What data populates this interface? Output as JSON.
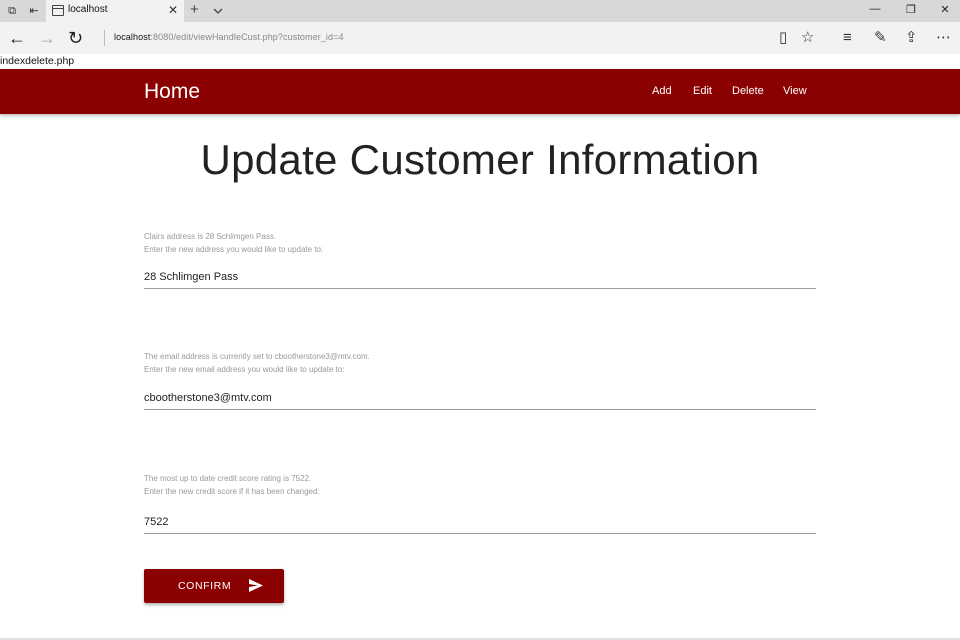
{
  "browser": {
    "tab_title": "localhost",
    "new_tab_icon": "+",
    "tab_close_icon": "✕",
    "url_host": "localhost",
    "url_rest": ":8080/edit/viewHandleCust.php?customer_id=4"
  },
  "debug_text": "indexdelete.php",
  "navbar": {
    "brand": "Home",
    "links": [
      "Add",
      "Edit",
      "Delete",
      "View"
    ],
    "color": "#8b0000"
  },
  "page": {
    "title": "Update Customer Information"
  },
  "fields": [
    {
      "helper_line1": "Clairs address is 28 Schlimgen Pass.",
      "helper_line2": "Enter the new address you would like to update to:",
      "value": "28 Schlimgen Pass"
    },
    {
      "helper_line1": "The email address is currently set to cbootherstone3@mtv.com.",
      "helper_line2": "Enter the new email address you would like to update to:",
      "value": "cbootherstone3@mtv.com"
    },
    {
      "helper_line1": "The most up to date credit score rating is 7522.",
      "helper_line2": "Enter the new credit score if it has been changed:",
      "value": "7522"
    }
  ],
  "confirm_button": {
    "label": "CONFIRM",
    "icon": "send-icon"
  }
}
